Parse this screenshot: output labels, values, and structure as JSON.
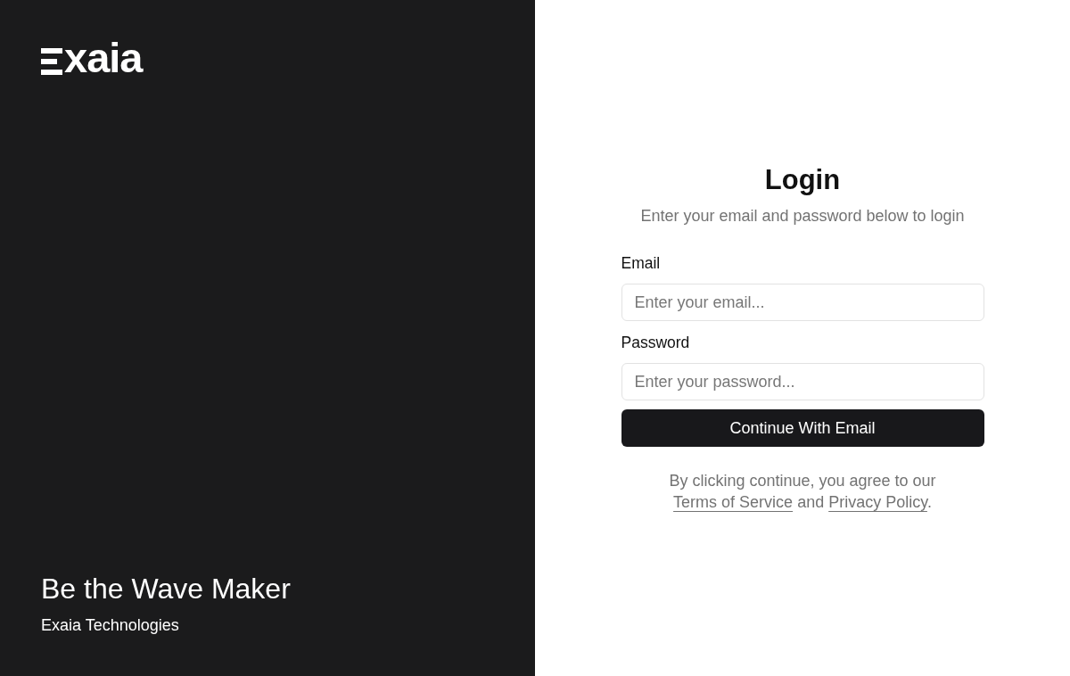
{
  "brand": {
    "logo_text": "xaia",
    "tagline": "Be the Wave Maker",
    "company": "Exaia Technologies"
  },
  "login": {
    "title": "Login",
    "subtitle": "Enter your email and password below to login",
    "fields": [
      {
        "label": "Email",
        "placeholder": "Enter your email..."
      },
      {
        "label": "Password",
        "placeholder": "Enter your password..."
      }
    ],
    "button": "Continue With Email",
    "legal": {
      "lead": "By clicking continue, you agree to our",
      "terms_link": "Terms of Service",
      "joiner": "and",
      "privacy_link": "Privacy Policy",
      "end": "."
    }
  }
}
